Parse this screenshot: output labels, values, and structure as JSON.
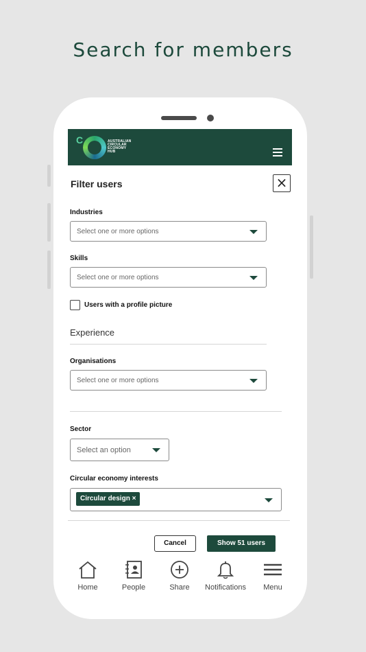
{
  "headline": "Search for members",
  "app": {
    "logo_lines": [
      "AUSTRALIAN",
      "CIRCULAR",
      "ECONOMY",
      "HUB"
    ],
    "brand_color": "#1d4a3c",
    "menu_icon": "hamburger-icon"
  },
  "filter": {
    "title": "Filter users",
    "close_icon": "close-icon",
    "industries": {
      "label": "Industries",
      "placeholder": "Select one or more options"
    },
    "skills": {
      "label": "Skills",
      "placeholder": "Select one or more options"
    },
    "profile_picture": {
      "label": "Users with a profile picture",
      "checked": false
    },
    "experience_heading": "Experience",
    "organisations": {
      "label": "Organisations",
      "placeholder": "Select one or more options"
    },
    "sector": {
      "label": "Sector",
      "placeholder": "Select an option"
    },
    "ce_interests": {
      "label": "Circular economy interests",
      "tags": [
        "Circular design ×"
      ]
    },
    "cancel_label": "Cancel",
    "show_label": "Show 51 users"
  },
  "nav": [
    {
      "label": "Home",
      "icon": "home-icon"
    },
    {
      "label": "People",
      "icon": "people-icon"
    },
    {
      "label": "Share",
      "icon": "plus-circle-icon"
    },
    {
      "label": "Notifications",
      "icon": "bell-icon"
    },
    {
      "label": "Menu",
      "icon": "menu-icon"
    }
  ]
}
